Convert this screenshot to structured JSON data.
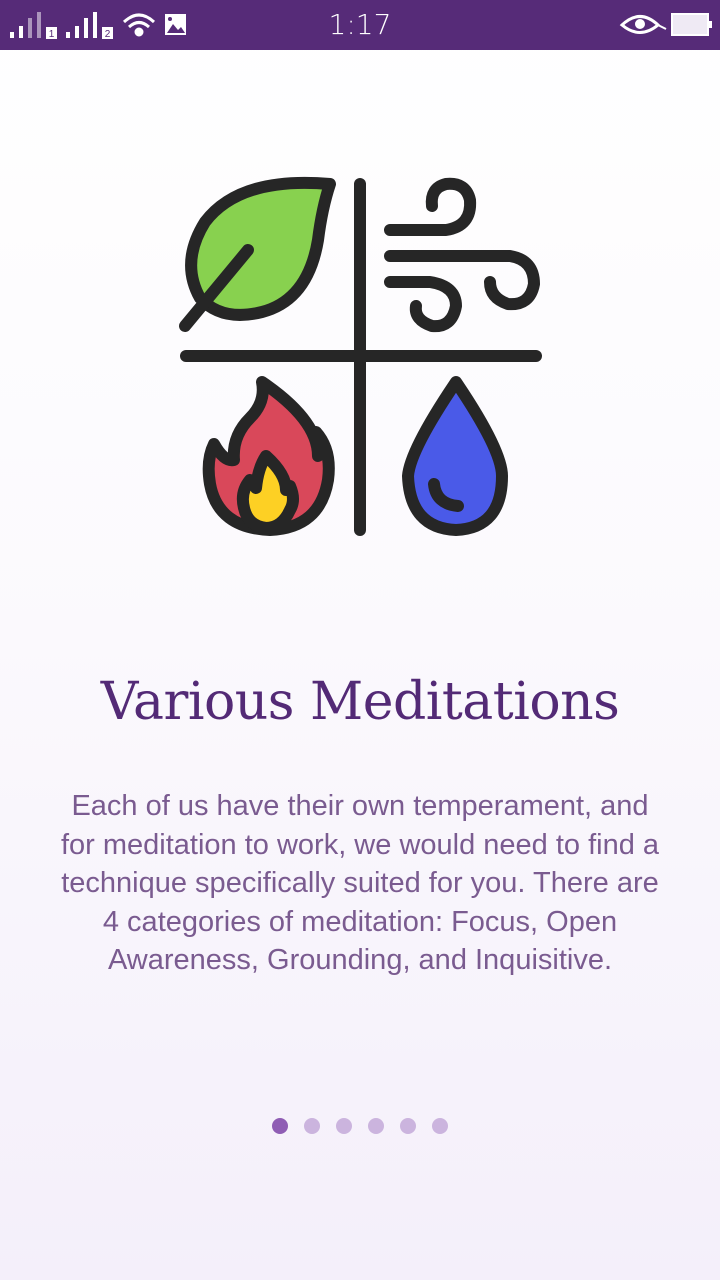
{
  "status_bar": {
    "time": "1:17",
    "sim1": "1",
    "sim2": "2",
    "icons": [
      "signal-icon",
      "wifi-icon",
      "image-icon",
      "eye-icon",
      "battery-icon"
    ],
    "background": "#562b78"
  },
  "onboarding": {
    "title": "Various Meditations",
    "description": "Each of us have their own temperament, and for meditation to work, we would need to find a technique specifically suited for you. There are 4 categories of meditation: Focus, Open Awareness, Grounding, and Inquisitive.",
    "illustration_icons": [
      "leaf-icon",
      "wind-icon",
      "fire-icon",
      "water-drop-icon"
    ],
    "page_count": 6,
    "current_page": 1
  },
  "colors": {
    "title": "#532a76",
    "text": "#7a5b90",
    "dot_active": "#8f5db4",
    "dot_inactive": "#cbb4de",
    "leaf": "#88d14f",
    "fire": "#d9485a",
    "flame": "#fdd024",
    "water": "#4a5ae8"
  }
}
